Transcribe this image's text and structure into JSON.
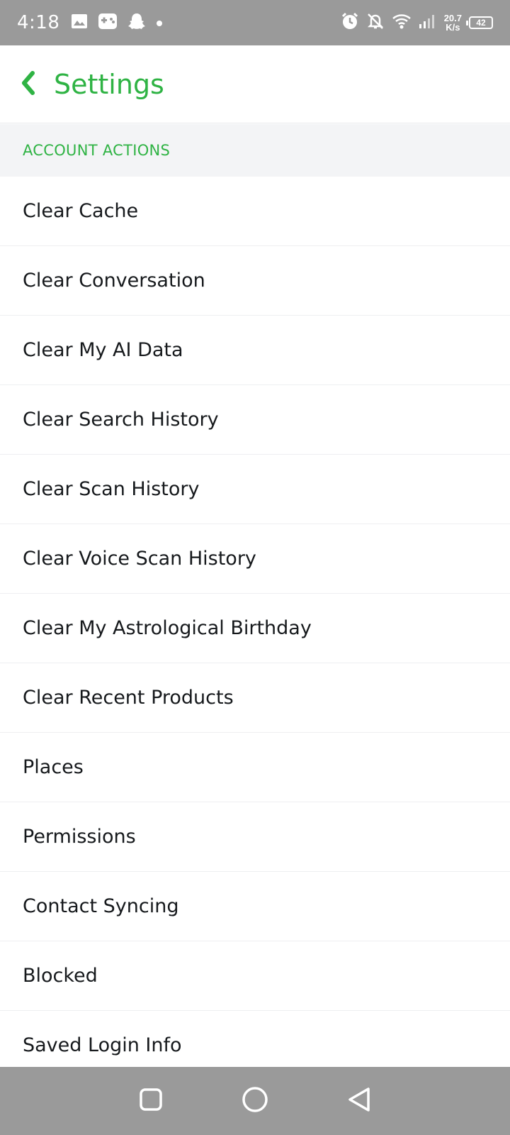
{
  "status_bar": {
    "time": "4:18",
    "net_speed_value": "20.7",
    "net_speed_unit": "K/s",
    "battery": "42",
    "left_icons": [
      "image-icon",
      "game-controller-icon",
      "snapchat-ghost-icon",
      "dot-icon"
    ],
    "right_icons": [
      "alarm-icon",
      "bell-off-icon",
      "wifi-icon",
      "signal-icon",
      "battery-icon"
    ]
  },
  "header": {
    "back_icon": "chevron-left-icon",
    "title": "Settings"
  },
  "section": {
    "title": "ACCOUNT ACTIONS"
  },
  "items": [
    {
      "label": "Clear Cache"
    },
    {
      "label": "Clear Conversation"
    },
    {
      "label": "Clear My AI Data"
    },
    {
      "label": "Clear Search History"
    },
    {
      "label": "Clear Scan History"
    },
    {
      "label": "Clear Voice Scan History"
    },
    {
      "label": "Clear My Astrological Birthday"
    },
    {
      "label": "Clear Recent Products"
    },
    {
      "label": "Places"
    },
    {
      "label": "Permissions"
    },
    {
      "label": "Contact Syncing"
    },
    {
      "label": "Blocked"
    },
    {
      "label": "Saved Login Info"
    }
  ],
  "nav_bar": {
    "buttons": [
      "recents-square-icon",
      "home-circle-icon",
      "back-triangle-icon"
    ]
  },
  "colors": {
    "accent": "#2fb344",
    "status_bar_bg": "#9a9a9a",
    "section_bg": "#f3f4f6",
    "text_primary": "#16191c"
  }
}
